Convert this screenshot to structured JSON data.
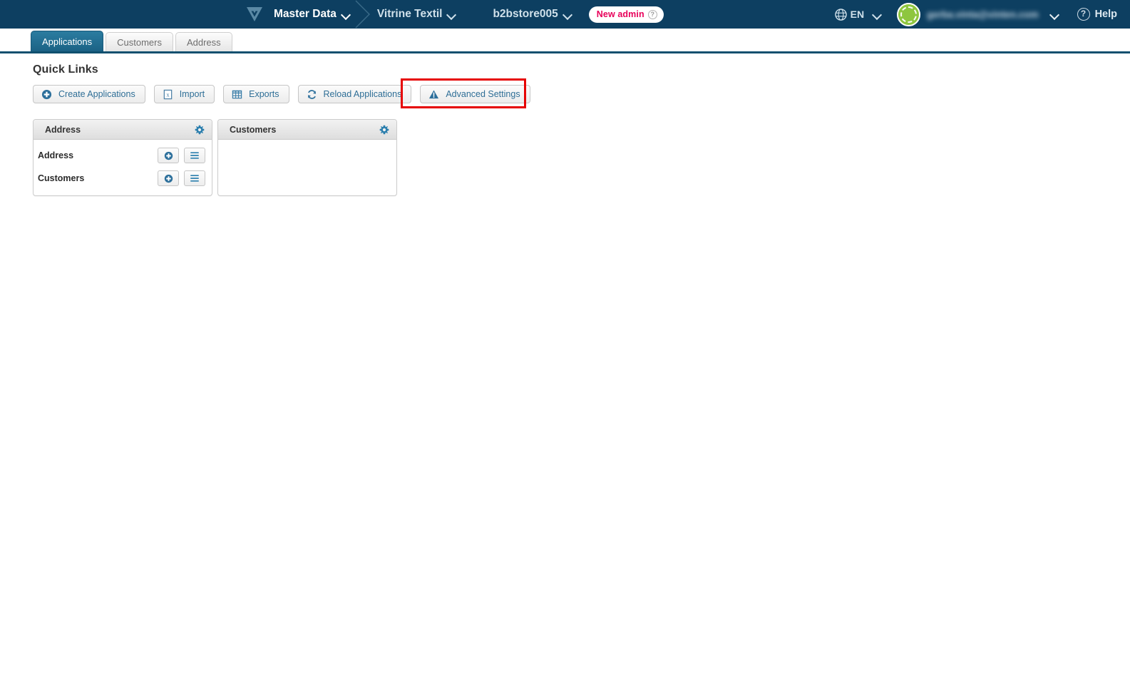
{
  "header": {
    "logo_icon": "vitrine-triangle-logo",
    "breadcrumb": [
      {
        "label": "Master Data",
        "caret": true,
        "primary": true
      },
      {
        "label": "Vitrine Textil",
        "caret": true,
        "primary": false
      },
      {
        "label": "b2bstore005",
        "caret": true,
        "primary": false
      }
    ],
    "new_admin_badge": {
      "label": "New admin",
      "help_icon": "question-mark-icon",
      "color": "#e8005a"
    },
    "language": {
      "label": "EN",
      "icon": "globe-icon"
    },
    "user": {
      "email": "gerba.vinta@vinten.com",
      "avatar_icon": "user-avatar",
      "avatar_color": "#8ec63f"
    },
    "help": {
      "label": "Help",
      "icon": "question-circle-icon"
    },
    "background_color": "#0d3f61"
  },
  "tabs": [
    {
      "label": "Applications",
      "active": true
    },
    {
      "label": "Customers",
      "active": false
    },
    {
      "label": "Address",
      "active": false
    }
  ],
  "main": {
    "page_title": "Quick Links",
    "toolbar": [
      {
        "label": "Create Applications",
        "icon": "plus-circle-icon",
        "highlighted": false
      },
      {
        "label": "Import",
        "icon": "spreadsheet-import-icon",
        "highlighted": false
      },
      {
        "label": "Exports",
        "icon": "table-grid-icon",
        "highlighted": false
      },
      {
        "label": "Reload Applications",
        "icon": "refresh-icon",
        "highlighted": false
      },
      {
        "label": "Advanced Settings",
        "icon": "warning-triangle-icon",
        "highlighted": true
      }
    ],
    "highlight_color": "#e60000",
    "panels": [
      {
        "title": "Address",
        "gear_icon": "gear-icon",
        "rows": [
          {
            "label": "Address",
            "add_icon": "plus-circle-icon",
            "menu_icon": "list-menu-icon"
          },
          {
            "label": "Customers",
            "add_icon": "plus-circle-icon",
            "menu_icon": "list-menu-icon"
          }
        ]
      },
      {
        "title": "Customers",
        "gear_icon": "gear-icon",
        "rows": []
      }
    ]
  }
}
